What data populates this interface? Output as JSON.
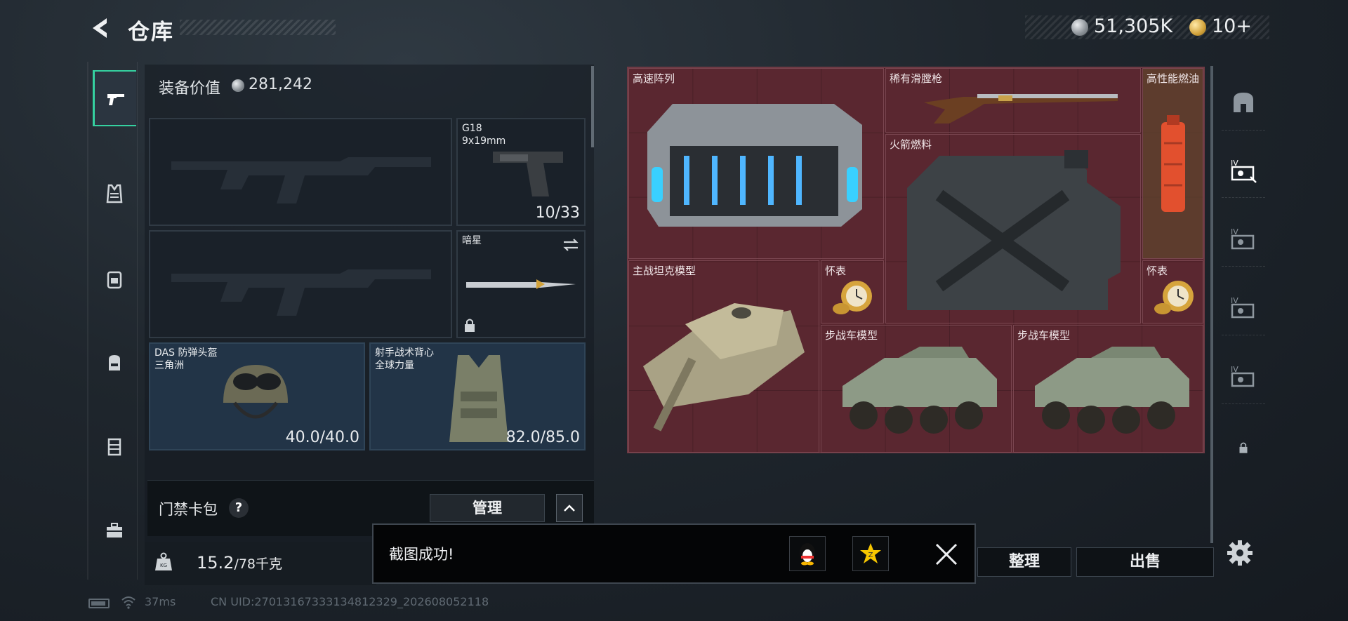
{
  "header": {
    "title": "仓库",
    "money": "51,305K",
    "tickets": "10+"
  },
  "left_rail": {
    "items": [
      {
        "icon": "pistol-icon",
        "active": true
      },
      {
        "icon": "armor-icon",
        "active": false
      },
      {
        "icon": "chest-rig-icon",
        "active": false
      },
      {
        "icon": "backpack-icon",
        "active": false
      },
      {
        "icon": "case-icon",
        "active": false
      },
      {
        "icon": "toolbox-icon",
        "active": false
      }
    ]
  },
  "loadout": {
    "value_label": "装备价值",
    "value": "281,242",
    "primary_slot_1": {
      "label": ""
    },
    "primary_slot_2": {
      "label": ""
    },
    "pistol": {
      "name": "G18",
      "caliber": "9x19mm",
      "ammo": "10/33"
    },
    "melee": {
      "name": "暗星"
    },
    "helmet": {
      "name": "DAS 防弹头盔",
      "faction": "三角洲",
      "durability": "40.0/40.0"
    },
    "armor": {
      "name": "射手战术背心",
      "faction": "全球力量",
      "durability": "82.0/85.0"
    },
    "card_pack_label": "门禁卡包",
    "help": "?",
    "manage_label": "管理",
    "weight_current": "15.2",
    "weight_max": "/78千克"
  },
  "stash_items": [
    {
      "name": "高速阵列"
    },
    {
      "name": "稀有滑膛枪"
    },
    {
      "name": "高性能燃油"
    },
    {
      "name": "火箭燃料"
    },
    {
      "name": "主战坦克模型"
    },
    {
      "name": "怀表"
    },
    {
      "name": "怀表"
    },
    {
      "name": "步战车模型"
    },
    {
      "name": "步战车模型"
    }
  ],
  "right_rail": {
    "items": [
      "stash-main-icon",
      "stash-tab-icon",
      "stash-tab-icon",
      "stash-tab-icon",
      "stash-tab-icon",
      "lock-icon"
    ]
  },
  "actions": {
    "sort_label": "整理",
    "sell_label": "出售"
  },
  "toast": {
    "message": "截图成功!"
  },
  "status": {
    "ping": "37ms",
    "uid": "CN UID:270131673331348123​29_202608052118"
  },
  "colors": {
    "accent": "#35d1a0",
    "grid_red": "#5a2730"
  }
}
